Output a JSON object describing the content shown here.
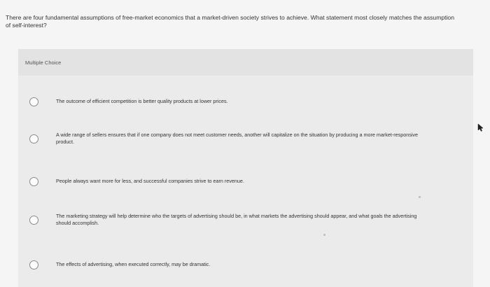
{
  "question": {
    "text": "There are four fundamental assumptions of free-market economics that a market-driven society strives to achieve. What statement most closely matches the assumption of self-interest?"
  },
  "panel": {
    "type_label": "Multiple Choice"
  },
  "choices": [
    {
      "text": "The outcome of efficient competition is better quality products at lower prices."
    },
    {
      "text": "A wide range of sellers ensures that if one company does not meet customer needs, another will capitalize on the situation by producing a more market-responsive product."
    },
    {
      "text": "People always want more for less, and successful companies strive to earn revenue."
    },
    {
      "text": "The marketing strategy will help determine who the targets of advertising should be, in what markets the advertising should appear, and what goals the advertising should accomplish."
    },
    {
      "text": "The effects of advertising, when executed correctly, may be dramatic."
    }
  ],
  "colors": {
    "page_bg": "#f5f5f5",
    "panel_bg": "#ebebeb",
    "radio_border": "#8a8a8a"
  },
  "icons": {
    "cursor": "mouse-pointer-icon"
  }
}
